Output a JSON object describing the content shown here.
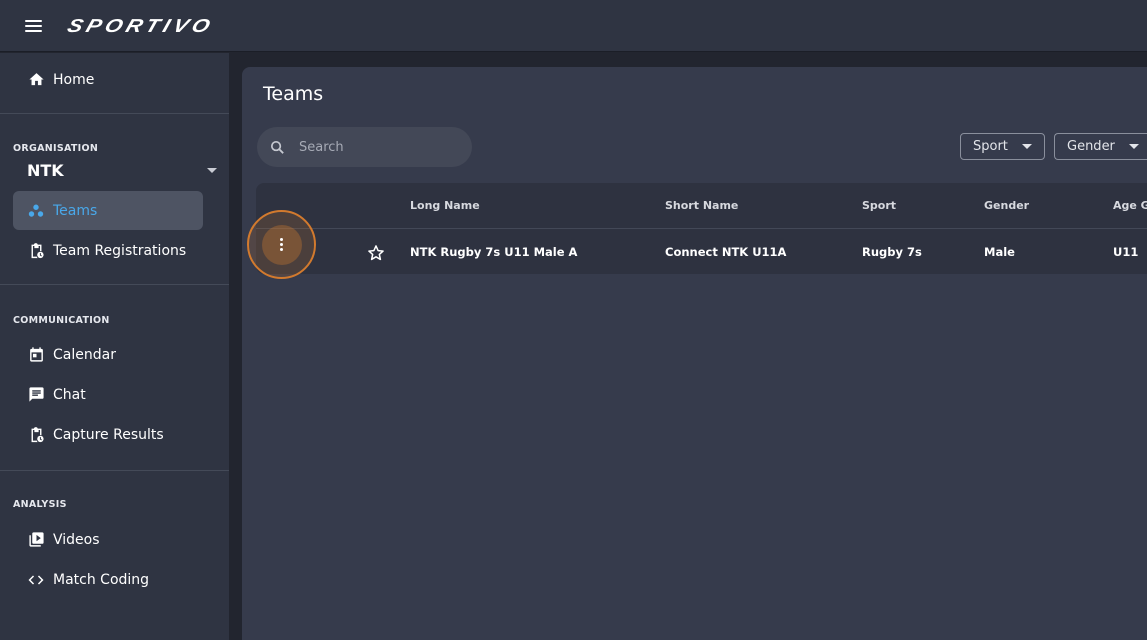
{
  "app": {
    "logo_text": "SPORTIVO"
  },
  "sidebar": {
    "home_label": "Home",
    "organisation_label": "ORGANISATION",
    "organisation_value": "NTK",
    "org_items": [
      {
        "label": "Teams",
        "icon": "group-icon",
        "active": true
      },
      {
        "label": "Team Registrations",
        "icon": "clipboard-icon",
        "active": false
      }
    ],
    "communication_label": "COMMUNICATION",
    "communication_items": [
      {
        "label": "Calendar",
        "icon": "calendar-icon"
      },
      {
        "label": "Chat",
        "icon": "chat-icon"
      },
      {
        "label": "Capture Results",
        "icon": "clipboard-icon"
      }
    ],
    "analysis_label": "ANALYSIS",
    "analysis_items": [
      {
        "label": "Videos",
        "icon": "video-library-icon"
      },
      {
        "label": "Match Coding",
        "icon": "code-icon"
      }
    ]
  },
  "main": {
    "title": "Teams",
    "search_placeholder": "Search",
    "filters": {
      "sport": "Sport",
      "gender": "Gender"
    },
    "table": {
      "columns": [
        "Long Name",
        "Short Name",
        "Sport",
        "Gender",
        "Age G"
      ],
      "rows": [
        {
          "long_name": "NTK Rugby 7s U11 Male A",
          "short_name": "Connect NTK U11A",
          "sport": "Rugby 7s",
          "gender": "Male",
          "age_group": "U11"
        }
      ]
    }
  },
  "colors": {
    "accent": "#49a8ea",
    "highlight": "#d27a2e",
    "sidebar_bg": "#2f3442",
    "content_bg": "#363b4c"
  }
}
